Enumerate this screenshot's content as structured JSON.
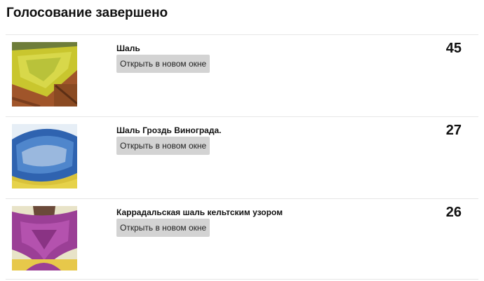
{
  "header": {
    "title": "Голосование завершено"
  },
  "items": [
    {
      "name": "Шаль",
      "button_label": "Открыть в новом окне",
      "votes": "45",
      "image": "yellow-shawl-photo"
    },
    {
      "name": "Шаль Гроздь Винограда.",
      "button_label": "Открыть в новом окне",
      "votes": "27",
      "image": "blue-shawl-photo"
    },
    {
      "name": "Каррадальская шаль кельтским узором",
      "button_label": "Открыть в новом окне",
      "votes": "26",
      "image": "purple-shawl-photo"
    }
  ]
}
